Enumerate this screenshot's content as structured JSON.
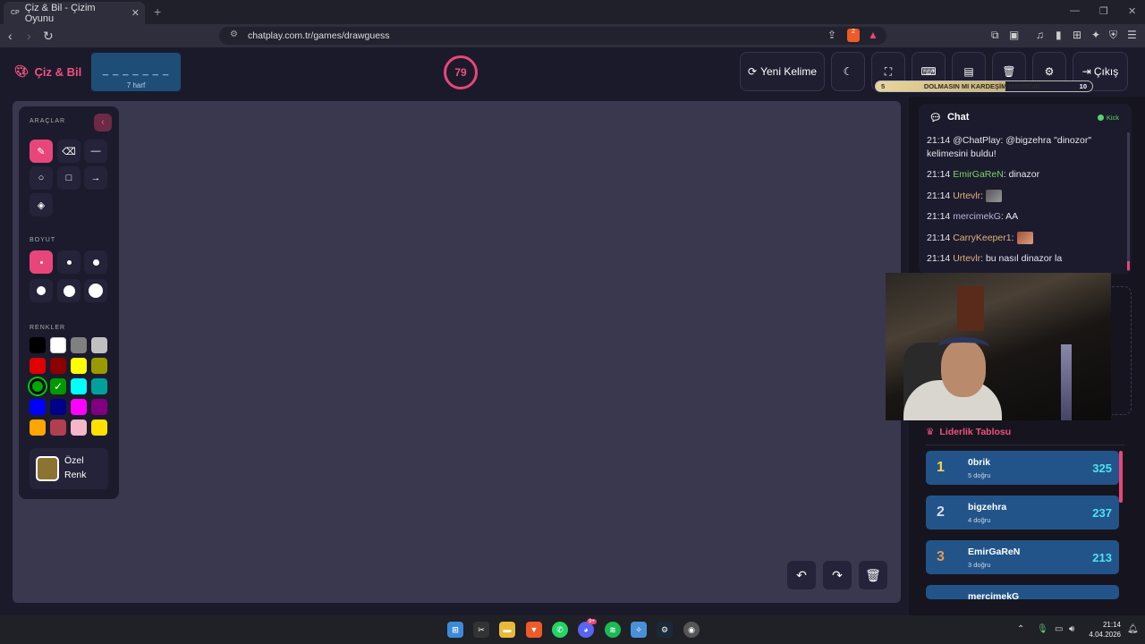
{
  "browser": {
    "tab_title": "Çiz & Bil - Çizim Oyunu",
    "tab_favicon": "CP",
    "url": "chatplay.com.tr/games/drawguess",
    "brave_badge": "2"
  },
  "header": {
    "logo_text": "Çiz & Bil",
    "word_dashes": "_ _ _ _ _ _ _",
    "word_length": "7 harf",
    "timer": "79",
    "new_word_label": "Yeni Kelime",
    "exit_label": "Çıkış",
    "progress": {
      "left": "5",
      "text": "DOLMASIN MI KARDEŞİM HAYIRDIR",
      "right": "10",
      "fill": 0.6
    }
  },
  "tools": {
    "tools_label": "ARAÇLAR",
    "size_label": "BOYUT",
    "colors_label": "RENKLER",
    "custom_color_line1": "Özel",
    "custom_color_line2": "Renk",
    "custom_color": "#8b7431",
    "swatches": [
      "#000000",
      "#ffffff",
      "#808080",
      "#c0c0c0",
      "#e00000",
      "#8b0000",
      "#ffff00",
      "#9a9a00",
      "#00aa00",
      "#009900",
      "#00ffff",
      "#00a19a",
      "#0000ff",
      "#00008b",
      "#ff00ff",
      "#800080",
      "#ffa500",
      "#b04050",
      "#f4b6c8",
      "#ffe000"
    ]
  },
  "chat": {
    "title": "Chat",
    "platform": "Kick",
    "messages": [
      {
        "time": "21:14",
        "user": "@ChatPlay",
        "text": ": @bigzehra \"dinozor\"",
        "text2": "kelimesini buldu!",
        "cls": ""
      },
      {
        "time": "21:14",
        "user": "EmirGaReN",
        "text": ": dinazor",
        "cls": "u-green"
      },
      {
        "time": "21:14",
        "user": "Urtevlr",
        "text": ":",
        "cls": "u-gold",
        "emote": true
      },
      {
        "time": "21:14",
        "user": "mercimekG",
        "text": ": AA",
        "cls": "u-lav"
      },
      {
        "time": "21:14",
        "user": "CarryKeeper1",
        "text": ":",
        "cls": "u-gold",
        "emote": true
      },
      {
        "time": "21:14",
        "user": "Urtevlr",
        "text": ": bu nasıl dinazor la",
        "cls": "u-gold"
      }
    ]
  },
  "leaderboard": {
    "title": "Liderlik Tablosu",
    "rows": [
      {
        "rank": "1",
        "name": "0brik",
        "sub": "5 doğru",
        "score": "325",
        "rank_color": "#f5d547"
      },
      {
        "rank": "2",
        "name": "bigzehra",
        "sub": "4 doğru",
        "score": "237",
        "rank_color": "#d8dce6"
      },
      {
        "rank": "3",
        "name": "EmirGaReN",
        "sub": "3 doğru",
        "score": "213",
        "rank_color": "#e09a57"
      },
      {
        "rank": "",
        "name": "mercimekG",
        "sub": "",
        "score": "",
        "rank_color": "#d8dce6"
      }
    ]
  },
  "taskbar": {
    "time": "21:14",
    "date": "4.04.2026",
    "discord_badge": "9+"
  }
}
